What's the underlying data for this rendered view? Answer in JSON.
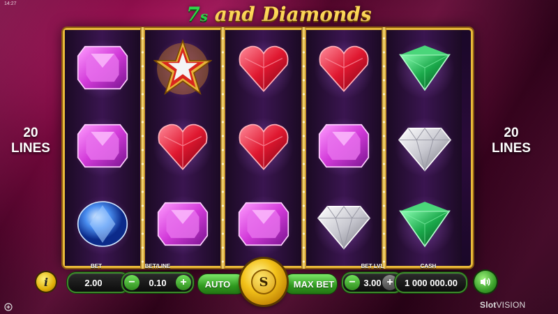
{
  "status_bar": {
    "time": "14:27"
  },
  "game": {
    "title_parts": {
      "seven": "7",
      "s": "s",
      "rest": " and Diamonds"
    },
    "lines_left": "20\nLINES",
    "lines_right": "20\nLINES"
  },
  "reels": [
    [
      "pink-square-gem",
      "pink-square-gem",
      "blue-round-gem"
    ],
    [
      "star",
      "red-heart-gem",
      "pink-square-gem"
    ],
    [
      "red-heart-gem",
      "red-heart-gem",
      "pink-square-gem"
    ],
    [
      "red-heart-gem",
      "pink-square-gem",
      "white-diamond"
    ],
    [
      "green-triangle-gem",
      "white-diamond",
      "green-triangle-gem"
    ]
  ],
  "controls": {
    "bet_label": "BET",
    "bet_value": "2.00",
    "bet_line_label": "BET/LINE",
    "bet_line_value": "0.10",
    "minus": "−",
    "plus": "+",
    "auto_label": "AUTO",
    "spin_symbol": "S",
    "max_bet_label": "MAX BET",
    "bet_lvl_label": "BET LVL",
    "bet_lvl_value": "3.00",
    "cash_label": "CASH",
    "cash_value": "1 000 000.00",
    "info_symbol": "i"
  },
  "brand": {
    "bold": "Slot",
    "light": "VISION"
  },
  "colors": {
    "gold": "#e9b93a",
    "button_green": "#2f9a1e",
    "background": "#6a0737"
  }
}
